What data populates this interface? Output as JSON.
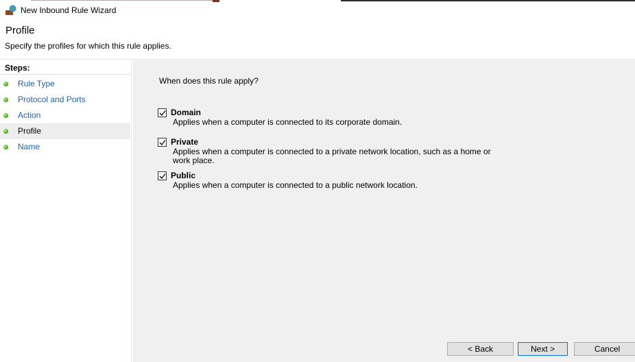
{
  "window": {
    "title": "New Inbound Rule Wizard"
  },
  "header": {
    "title": "Profile",
    "subtitle": "Specify the profiles for which this rule applies."
  },
  "sidebar": {
    "steps_title": "Steps:",
    "steps": [
      {
        "label": "Rule Type",
        "active": false
      },
      {
        "label": "Protocol and Ports",
        "active": false
      },
      {
        "label": "Action",
        "active": false
      },
      {
        "label": "Profile",
        "active": true
      },
      {
        "label": "Name",
        "active": false
      }
    ]
  },
  "content": {
    "question": "When does this rule apply?",
    "options": [
      {
        "label": "Domain",
        "checked": true,
        "description": "Applies when a computer is connected to its corporate domain."
      },
      {
        "label": "Private",
        "checked": true,
        "description": "Applies when a computer is connected to a private network location, such as a home or work place."
      },
      {
        "label": "Public",
        "checked": true,
        "description": "Applies when a computer is connected to a public network location."
      }
    ]
  },
  "buttons": {
    "back": "< Back",
    "next": "Next >",
    "cancel": "Cancel"
  },
  "colors": {
    "link": "#1a63b8",
    "content_bg": "#f0f0f0",
    "active_step_bg": "#ededed",
    "primary_border": "#0078d7",
    "step_dot": "#4fb51e"
  },
  "icons": {
    "app": "firewall-globe-icon",
    "step": "green-dot-icon",
    "check": "checkmark-icon"
  }
}
